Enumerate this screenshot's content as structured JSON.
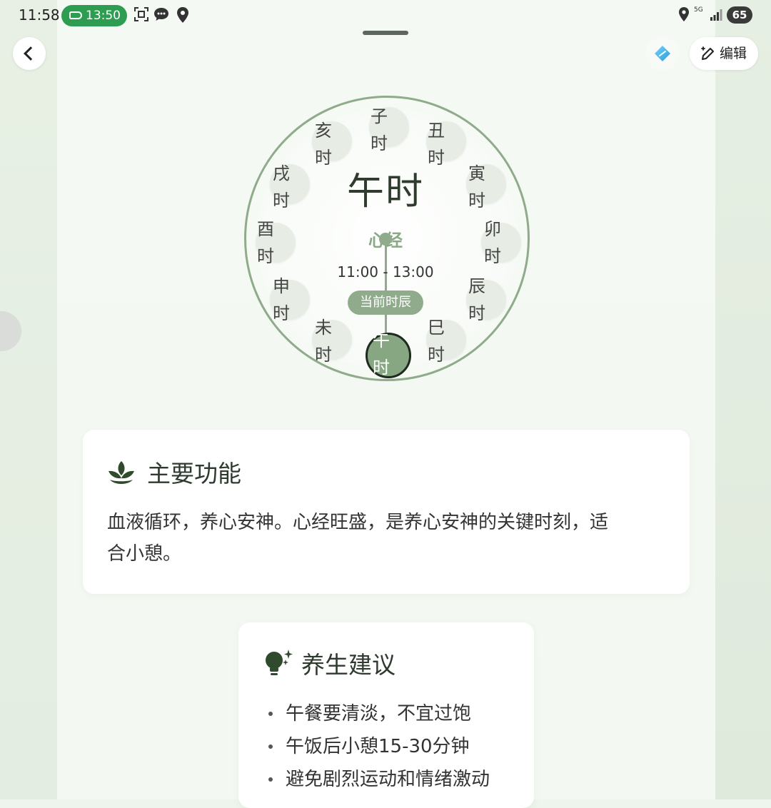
{
  "status_bar": {
    "time": "11:58",
    "pill_time": "13:50",
    "network": "5G",
    "battery": "65"
  },
  "toolbar": {
    "edit_label": "编辑"
  },
  "dial": {
    "current_name": "午时",
    "meridian": "心经",
    "time_range": "11:00 - 13:00",
    "current_badge": "当前时辰",
    "hours": [
      {
        "top": "子",
        "bottom": "时"
      },
      {
        "top": "丑",
        "bottom": "时"
      },
      {
        "top": "寅",
        "bottom": "时"
      },
      {
        "top": "卯",
        "bottom": "时"
      },
      {
        "top": "辰",
        "bottom": "时"
      },
      {
        "top": "巳",
        "bottom": "时"
      },
      {
        "top": "午",
        "bottom": "时"
      },
      {
        "top": "未",
        "bottom": "时"
      },
      {
        "top": "申",
        "bottom": "时"
      },
      {
        "top": "酉",
        "bottom": "时"
      },
      {
        "top": "戌",
        "bottom": "时"
      },
      {
        "top": "亥",
        "bottom": "时"
      }
    ]
  },
  "function_card": {
    "title": "主要功能",
    "line1": "血液循环，养心安神。心经旺盛，是养心安神的关键时刻，适",
    "line2": "合小憩。"
  },
  "tips_card": {
    "title": "养生建议",
    "items": [
      "午餐要清淡，不宜过饱",
      "午饭后小憩15-30分钟",
      "避免剧烈运动和情绪激动"
    ]
  },
  "colors": {
    "accent": "#8fab8c",
    "status_pill": "#2e9d52",
    "active_node": "#86a782"
  }
}
